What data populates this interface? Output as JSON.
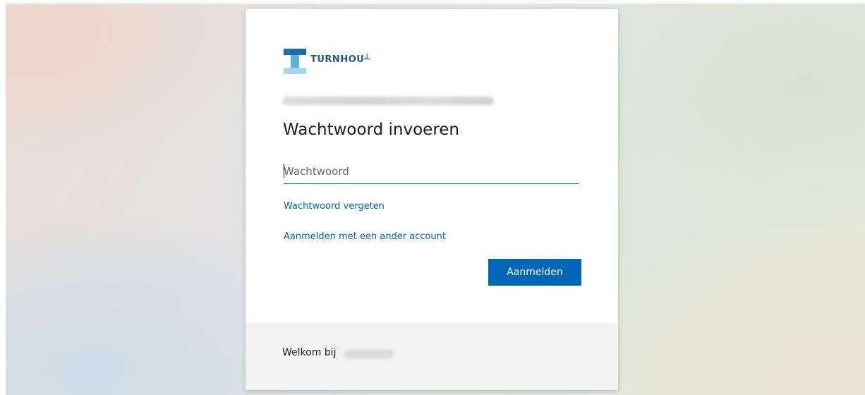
{
  "logo": {
    "text": "TURNHOU┴",
    "mark_colors": [
      "#1c6dab",
      "#5fb1d8",
      "#a8d6ec"
    ]
  },
  "login": {
    "title": "Wachtwoord invoeren",
    "password_placeholder": "Wachtwoord",
    "password_value": "",
    "forgot_password_link": "Wachtwoord vergeten",
    "other_account_link": "Aanmelden met een ander account",
    "signin_button": "Aanmelden"
  },
  "footer": {
    "welcome_text": "Welkom bij"
  },
  "colors": {
    "accent": "#0067b8",
    "footer_bg": "#f2f2f2"
  }
}
